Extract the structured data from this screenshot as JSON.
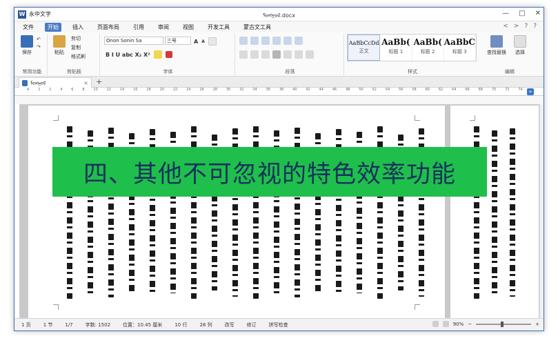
{
  "app": {
    "name": "永中文字",
    "logo": "W",
    "document_title": "ᠮᠣᠩᠭᠣᠯ.docx"
  },
  "window_controls": [
    "—",
    "□",
    "✕"
  ],
  "menu": {
    "items": [
      "文件",
      "开始",
      "插入",
      "页面布局",
      "引用",
      "审阅",
      "视图",
      "开发工具",
      "蒙古文工具"
    ],
    "active_index": 1,
    "right_icons": [
      "<",
      ">",
      "?",
      "?"
    ]
  },
  "ribbon": {
    "groups": [
      "常用功能",
      "剪贴板",
      "字体",
      "段落",
      "样式",
      "编辑"
    ],
    "common": {
      "save": "保存",
      "undo": "↶",
      "redo": "↷"
    },
    "clipboard": {
      "paste": "粘贴",
      "cut": "剪切",
      "copy": "复制",
      "format_painter": "格式刷"
    },
    "font": {
      "family": "Onon Sonin Sa",
      "size": "三号",
      "grow": "A",
      "shrink": "A",
      "format_row": "B  I  U  abc  X₂  X²"
    },
    "styles": [
      {
        "sample": "AaBbCcDd",
        "name": "正文"
      },
      {
        "sample": "AaBb(",
        "name": "标题 1"
      },
      {
        "sample": "AaBb(",
        "name": "标题 2"
      },
      {
        "sample": "AaBbC",
        "name": "标题 3"
      }
    ],
    "editing": {
      "find_replace": "查找替换",
      "select": "选择"
    },
    "accent": "#4a7cc4"
  },
  "tab": {
    "label": "ᠮᠣᠩᠭᠣᠯ",
    "close": "×",
    "add": "+"
  },
  "ruler": {
    "ticks": [
      "4",
      "2",
      "2",
      "4",
      "6",
      "8",
      "10",
      "12",
      "14",
      "16",
      "18",
      "20",
      "22",
      "24",
      "26",
      "28",
      "30",
      "32",
      "34",
      "36",
      "38",
      "40",
      "42",
      "44",
      "46",
      "48",
      "50",
      "52",
      "54",
      "56",
      "58",
      "60",
      "62",
      "64",
      "66",
      "68",
      "70",
      "72",
      "74"
    ]
  },
  "banner": {
    "text": "四、其他不可忽视的特色效率功能",
    "bg": "#1fbf4c",
    "fg": "#16325c"
  },
  "status": {
    "page": "1 页",
    "section": "1 节",
    "pages": "1/7",
    "words": "字数: 1502",
    "position": "位置：10.45 厘米",
    "line": "10 行",
    "column": "28 列",
    "overtype": "改写",
    "revise": "修订",
    "spell": "拼写检查",
    "zoom": "90%"
  }
}
